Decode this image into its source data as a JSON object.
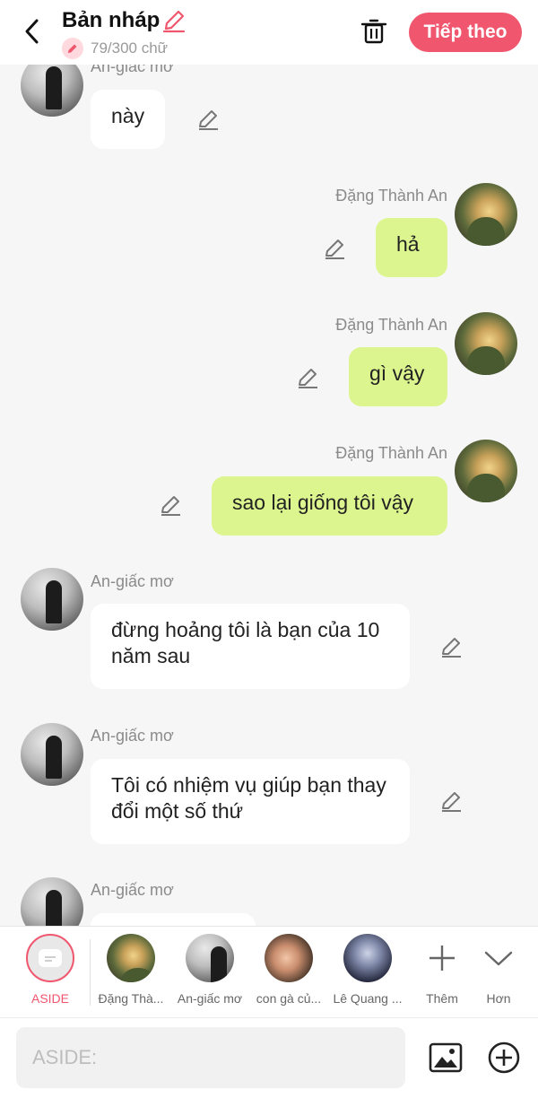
{
  "header": {
    "title": "Bản nháp",
    "counter": "79/300 chữ",
    "next_label": "Tiếp theo"
  },
  "colors": {
    "accent": "#f0566d",
    "outgoing_bubble": "#dcf58f",
    "incoming_bubble": "#ffffff",
    "background": "#f6f6f6"
  },
  "messages": [
    {
      "sender": "An-giác mơ",
      "text": "này",
      "side": "left",
      "avatar": "dark"
    },
    {
      "sender": "Đặng Thành An",
      "text": "hả",
      "side": "right",
      "avatar": "green"
    },
    {
      "sender": "Đặng Thành An",
      "text": "gì vậy",
      "side": "right",
      "avatar": "green"
    },
    {
      "sender": "Đặng Thành An",
      "text": "sao lại giống tôi vậy",
      "side": "right",
      "avatar": "green"
    },
    {
      "sender": "An-giấc mơ",
      "text": "đừng hoảng tôi là bạn của 10 năm sau",
      "side": "left",
      "avatar": "dark"
    },
    {
      "sender": "An-giấc mơ",
      "text": "Tôi có nhiệm vụ giúp bạn thay đổi một số thứ",
      "side": "left",
      "avatar": "dark"
    },
    {
      "sender": "An-giấc mơ",
      "text": "",
      "side": "left",
      "avatar": "dark"
    }
  ],
  "character_strip": [
    {
      "label": "ASIDE",
      "type": "aside"
    },
    {
      "label": "Đặng Thà...",
      "type": "avatar-green"
    },
    {
      "label": "An-giấc mơ",
      "type": "avatar-dark"
    },
    {
      "label": "con gà củ...",
      "type": "avatar-brown"
    },
    {
      "label": "Lê Quang ...",
      "type": "avatar-navy"
    },
    {
      "label": "Thêm",
      "type": "plus-icon"
    },
    {
      "label": "Hơn",
      "type": "chevron-down-icon"
    }
  ],
  "input": {
    "placeholder": "ASIDE:"
  }
}
